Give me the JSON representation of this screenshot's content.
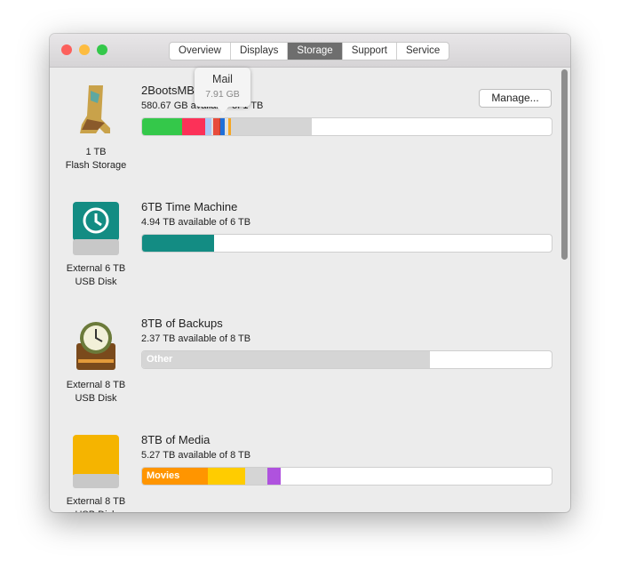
{
  "tabs": [
    "Overview",
    "Displays",
    "Storage",
    "Support",
    "Service"
  ],
  "active_tab": "Storage",
  "tooltip": {
    "title": "Mail",
    "size": "7.91 GB"
  },
  "manage_label": "Manage...",
  "disks": [
    {
      "name": "2BootsMBP",
      "available": "580.67 GB available of 1 TB",
      "caption1": "1 TB",
      "caption2": "Flash Storage",
      "icon": "boot-icon",
      "segments": [
        {
          "color": "#34c84a",
          "pct": 9.8
        },
        {
          "color": "#fc3158",
          "pct": 5.6
        },
        {
          "color": "#a9c8f5",
          "pct": 1.5
        },
        {
          "color": "#e0e0e0",
          "pct": 0.4
        },
        {
          "color": "#e74c3c",
          "pct": 1.5
        },
        {
          "color": "#c0392b",
          "pct": 0.4
        },
        {
          "color": "#1e6fd9",
          "pct": 1
        },
        {
          "color": "#e0e0e0",
          "pct": 0.8
        },
        {
          "color": "#f5a623",
          "pct": 0.7
        },
        {
          "color": "#d5d5d5",
          "pct": 19.7
        }
      ]
    },
    {
      "name": "6TB Time Machine",
      "available": "4.94 TB available of 6 TB",
      "caption1": "External 6 TB",
      "caption2": "USB Disk",
      "icon": "time-machine-disk-icon",
      "segments": [
        {
          "color": "#138c83",
          "pct": 17.6
        }
      ]
    },
    {
      "name": "8TB of Backups",
      "available": "2.37 TB available of 8 TB",
      "caption1": "External 8 TB",
      "caption2": "USB Disk",
      "icon": "backup-disk-icon",
      "segments": [
        {
          "color": "#d5d5d5",
          "pct": 70.3,
          "label": "Other"
        }
      ]
    },
    {
      "name": "8TB of Media",
      "available": "5.27 TB available of 8 TB",
      "caption1": "External 8 TB",
      "caption2": "USB Disk",
      "icon": "external-drive-icon",
      "segments": [
        {
          "color": "#ff9500",
          "pct": 16,
          "label": "Movies"
        },
        {
          "color": "#ffcc00",
          "pct": 9.2
        },
        {
          "color": "#d5d5d5",
          "pct": 5.3
        },
        {
          "color": "#af52de",
          "pct": 3.4
        }
      ]
    }
  ]
}
